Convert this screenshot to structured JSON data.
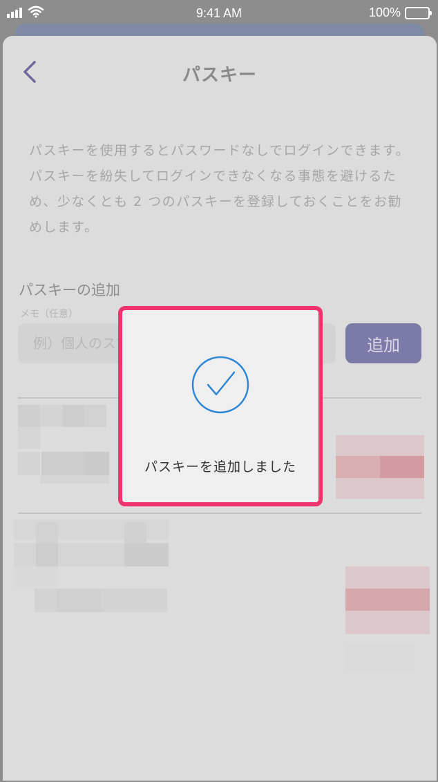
{
  "status_bar": {
    "time": "9:41 AM",
    "battery": "100%",
    "signal_icon": "signal-icon",
    "wifi_icon": "wifi-icon",
    "battery_icon": "battery-icon"
  },
  "nav": {
    "title": "パスキー",
    "back_icon": "chevron-left-icon"
  },
  "description": "パスキーを使用するとパスワードなしでログインできます。パスキーを紛失してログインできなくなる事態を避けるため、少なくとも 2 つのパスキーを登録しておくことをお勧めします。",
  "add_section": {
    "title": "パスキーの追加",
    "memo_label": "メモ（任意）",
    "memo_placeholder": "例）個人のスマートフォン",
    "add_button": "追加"
  },
  "dialog": {
    "message": "パスキーを追加しました",
    "icon": "check-circle-icon"
  },
  "colors": {
    "accent": "#7c7ba8",
    "dialog_border": "#f0336b",
    "check": "#2f86d6",
    "delete_blur": "#d49aa2"
  }
}
